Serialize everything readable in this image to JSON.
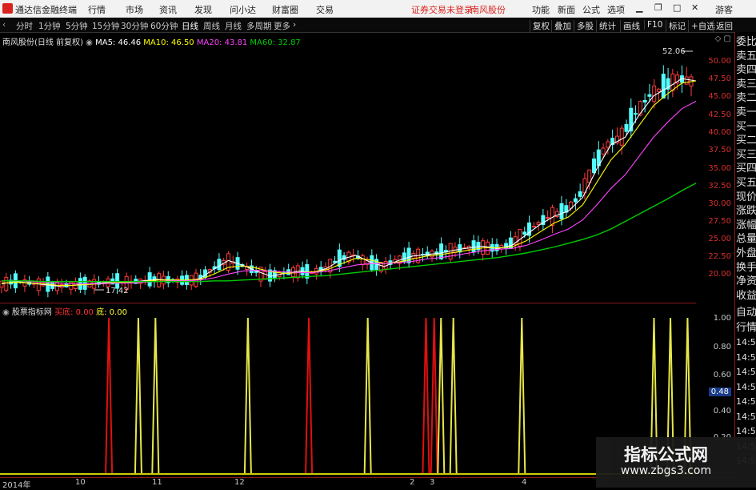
{
  "titlebar": {
    "app_name": "通达信金融终端",
    "menus": [
      "行情",
      "市场",
      "资讯",
      "发现",
      "问小达",
      "财富圈",
      "交易"
    ],
    "notice": "证券交易未登录",
    "stock": "南风股份",
    "right_menus": [
      "功能",
      "新面",
      "公式",
      "选项"
    ],
    "user": "游客"
  },
  "toolbar": {
    "periods": [
      "分时",
      "1分钟",
      "5分钟",
      "15分钟",
      "30分钟",
      "60分钟",
      "日线",
      "周线",
      "月线",
      "多周期",
      "更多"
    ],
    "active_period": "日线",
    "right_buttons": [
      "复权",
      "叠加",
      "多股",
      "统计",
      "画线",
      "F10",
      "标记",
      "+自选",
      "返回"
    ]
  },
  "main_chart": {
    "title": "南风股份(日线 前复权)",
    "ma": [
      {
        "label": "MA5: 46.46",
        "color": "#ffffff"
      },
      {
        "label": "MA10: 46.50",
        "color": "#ffff00"
      },
      {
        "label": "MA20: 43.81",
        "color": "#ff44ff"
      },
      {
        "label": "MA60: 32.87",
        "color": "#00cc00"
      }
    ],
    "high_label": "52.06",
    "low_label": "17.42",
    "y_labels": [
      "50.00",
      "47.50",
      "45.00",
      "42.50",
      "40.00",
      "37.50",
      "35.00",
      "32.50",
      "30.00",
      "27.50",
      "25.00",
      "22.50",
      "20.00"
    ]
  },
  "sub_chart": {
    "title": "股票指标网",
    "buy_label": "买底: 0.00",
    "bottom_label": "底: 0.00",
    "y_labels": [
      "1.00",
      "0.80",
      "0.60",
      "0.48",
      "0.40",
      "0.20"
    ],
    "current_value": "0.48"
  },
  "right_panel": {
    "items": [
      "委比",
      "卖五",
      "卖四",
      "卖三",
      "卖二",
      "卖一",
      "买一",
      "买二",
      "买三",
      "买四",
      "买五",
      "现价",
      "涨跌",
      "涨幅",
      "总量",
      "外盘",
      "换手",
      "净资",
      "收益"
    ],
    "items2": [
      "自动",
      "行情",
      "14:50",
      "14:50",
      "14:50",
      "14:50",
      "14:50",
      "14:50",
      "14:50",
      "14:50",
      "14:50"
    ]
  },
  "time_axis": {
    "labels": [
      "2014年",
      "10",
      "11",
      "12",
      "2",
      "3",
      "4"
    ]
  },
  "watermark": {
    "title": "指标公式网",
    "url": "www.zbgs3.com"
  },
  "chart_data": {
    "type": "line",
    "series": [
      {
        "name": "MA5",
        "values": [
          19.5,
          19.8,
          19.6,
          19.4,
          19.2,
          19.3,
          19.5,
          19.6,
          19.8,
          19.7,
          19.9,
          20.1,
          20.0,
          19.9,
          20.2,
          21.5,
          22.6,
          22.0,
          21.2,
          20.5,
          20.9,
          21.2,
          21.0,
          21.6,
          22.8,
          23.3,
          22.4,
          21.8,
          22.6,
          23.2,
          23.4,
          23.6,
          24.0,
          24.3,
          24.5,
          24.2,
          24.6,
          26.0,
          27.4,
          28.5,
          29.2,
          31.0,
          34.8,
          38.0,
          39.0,
          42.0,
          44.5,
          45.6,
          46.8,
          46.5
        ]
      },
      {
        "name": "MA10",
        "values": [
          19.6,
          19.7,
          19.6,
          19.5,
          19.3,
          19.3,
          19.4,
          19.5,
          19.7,
          19.7,
          19.8,
          20.0,
          20.0,
          20.0,
          20.1,
          20.8,
          21.7,
          21.9,
          21.6,
          21.1,
          20.9,
          21.0,
          21.1,
          21.4,
          22.2,
          22.9,
          22.7,
          22.2,
          22.4,
          22.8,
          23.2,
          23.4,
          23.7,
          24.0,
          24.3,
          24.3,
          24.4,
          25.2,
          26.4,
          27.6,
          28.4,
          30.0,
          33.0,
          36.0,
          38.0,
          40.6,
          43.2,
          44.8,
          46.2,
          46.5
        ]
      },
      {
        "name": "MA20",
        "values": [
          19.9,
          19.9,
          19.8,
          19.7,
          19.6,
          19.5,
          19.5,
          19.5,
          19.6,
          19.6,
          19.7,
          19.8,
          19.9,
          19.9,
          20.0,
          20.3,
          20.8,
          21.2,
          21.3,
          21.2,
          21.1,
          21.0,
          21.0,
          21.2,
          21.6,
          22.0,
          22.2,
          22.2,
          22.3,
          22.5,
          22.8,
          23.0,
          23.3,
          23.6,
          23.9,
          24.1,
          24.2,
          24.6,
          25.3,
          26.1,
          26.8,
          28.0,
          30.0,
          32.2,
          34.0,
          36.5,
          39.0,
          41.0,
          42.8,
          43.8
        ]
      },
      {
        "name": "MA60",
        "values": [
          19.9,
          19.9,
          19.9,
          19.8,
          19.8,
          19.8,
          19.8,
          19.8,
          19.8,
          19.8,
          19.8,
          19.8,
          19.8,
          19.8,
          19.8,
          19.9,
          19.9,
          20.0,
          20.1,
          20.2,
          20.3,
          20.4,
          20.5,
          20.6,
          20.8,
          21.0,
          21.2,
          21.4,
          21.6,
          21.8,
          22.0,
          22.2,
          22.4,
          22.6,
          22.8,
          23.0,
          23.3,
          23.6,
          24.0,
          24.4,
          24.9,
          25.4,
          26.0,
          26.8,
          27.8,
          28.8,
          29.8,
          30.8,
          31.9,
          32.9
        ]
      }
    ],
    "ylim": [
      17.0,
      53.0
    ],
    "signals": {
      "red": [
        0.152,
        0.444,
        0.615,
        0.627
      ],
      "yellow": [
        0.195,
        0.22,
        0.355,
        0.53,
        0.637,
        0.655,
        0.755,
        0.948,
        0.972,
        0.997
      ]
    }
  }
}
